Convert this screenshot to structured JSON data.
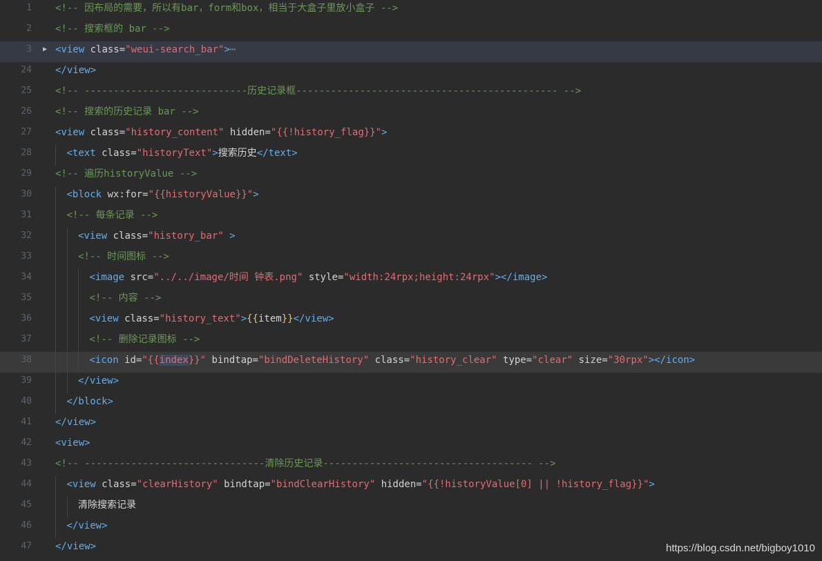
{
  "editor": {
    "lines": [
      {
        "num": "1",
        "indent": 0,
        "tokens": [
          [
            "c-comment",
            "<!-- 因布局的需要，所以有bar，form和box，相当于大盒子里放小盒子 -->"
          ]
        ]
      },
      {
        "num": "2",
        "indent": 0,
        "tokens": [
          [
            "c-comment",
            "<!-- 搜索框的 bar -->"
          ]
        ]
      },
      {
        "num": "3",
        "indent": 0,
        "fold": "▶",
        "highlight": "hl",
        "tokens": [
          [
            "c-tag",
            "<view"
          ],
          [
            "c-attr",
            " class="
          ],
          [
            "c-str",
            "\"weui-search_bar\""
          ],
          [
            "c-tag",
            ">"
          ],
          [
            "c-ellipsis",
            "⋯"
          ]
        ]
      },
      {
        "num": "24",
        "indent": 0,
        "tokens": [
          [
            "c-tag",
            "</view>"
          ]
        ]
      },
      {
        "num": "25",
        "indent": 0,
        "tokens": [
          [
            "c-comment",
            "<!-- ----------------------------历史记录框--------------------------------------------- -->"
          ]
        ]
      },
      {
        "num": "26",
        "indent": 0,
        "tokens": [
          [
            "c-comment",
            "<!-- 搜索的历史记录 bar -->"
          ]
        ]
      },
      {
        "num": "27",
        "indent": 0,
        "tokens": [
          [
            "c-tag",
            "<view"
          ],
          [
            "c-attr",
            " class="
          ],
          [
            "c-str",
            "\"history_content\""
          ],
          [
            "c-attr",
            " hidden="
          ],
          [
            "c-str",
            "\"{{!history_flag}}\""
          ],
          [
            "c-tag",
            ">"
          ]
        ]
      },
      {
        "num": "28",
        "indent": 1,
        "tokens": [
          [
            "c-tag",
            "<text"
          ],
          [
            "c-attr",
            " class="
          ],
          [
            "c-str",
            "\"historyText\""
          ],
          [
            "c-tag",
            ">"
          ],
          [
            "c-text",
            "搜索历史"
          ],
          [
            "c-tag",
            "</text>"
          ]
        ]
      },
      {
        "num": "29",
        "indent": 0,
        "tokens": [
          [
            "c-comment",
            "<!-- 遍历historyValue -->"
          ]
        ]
      },
      {
        "num": "30",
        "indent": 1,
        "tokens": [
          [
            "c-tag",
            "<block"
          ],
          [
            "c-attr",
            " wx:for="
          ],
          [
            "c-str",
            "\"{{historyValue}}\""
          ],
          [
            "c-tag",
            ">"
          ]
        ]
      },
      {
        "num": "31",
        "indent": 1,
        "tokens": [
          [
            "c-comment",
            "<!-- 每条记录 -->"
          ]
        ]
      },
      {
        "num": "32",
        "indent": 2,
        "tokens": [
          [
            "c-tag",
            "<view"
          ],
          [
            "c-attr",
            " class="
          ],
          [
            "c-str",
            "\"history_bar\""
          ],
          [
            "c-tag",
            " >"
          ]
        ]
      },
      {
        "num": "33",
        "indent": 2,
        "tokens": [
          [
            "c-comment",
            "<!-- 时间图标 -->"
          ]
        ]
      },
      {
        "num": "34",
        "indent": 3,
        "tokens": [
          [
            "c-tag",
            "<image"
          ],
          [
            "c-attr",
            " src="
          ],
          [
            "c-str",
            "\"../../image/时间 钟表.png\""
          ],
          [
            "c-attr",
            " style="
          ],
          [
            "c-str",
            "\"width:24rpx;height:24rpx\""
          ],
          [
            "c-tag",
            "></image>"
          ]
        ]
      },
      {
        "num": "35",
        "indent": 3,
        "tokens": [
          [
            "c-comment",
            "<!-- 内容 -->"
          ]
        ]
      },
      {
        "num": "36",
        "indent": 3,
        "tokens": [
          [
            "c-tag",
            "<view"
          ],
          [
            "c-attr",
            " class="
          ],
          [
            "c-str",
            "\"history_text\""
          ],
          [
            "c-tag",
            ">"
          ],
          [
            "c-brace",
            "{{"
          ],
          [
            "c-text",
            "item"
          ],
          [
            "c-brace",
            "}}"
          ],
          [
            "c-tag",
            "</view>"
          ]
        ]
      },
      {
        "num": "37",
        "indent": 3,
        "tokens": [
          [
            "c-comment",
            "<!-- 删除记录图标 -->"
          ]
        ]
      },
      {
        "num": "38",
        "indent": 3,
        "highlight": "hl-current",
        "tokens": [
          [
            "c-tag",
            "<icon"
          ],
          [
            "c-attr",
            " id="
          ],
          [
            "c-str",
            "\"{{"
          ],
          [
            "c-str sel",
            "index"
          ],
          [
            "c-str",
            "}}\""
          ],
          [
            "c-attr",
            " bindtap="
          ],
          [
            "c-str",
            "\"bindDeleteHistory\""
          ],
          [
            "c-attr",
            " class="
          ],
          [
            "c-str",
            "\"history_clear\""
          ],
          [
            "c-attr",
            " type="
          ],
          [
            "c-str",
            "\"clear\""
          ],
          [
            "c-attr",
            " size="
          ],
          [
            "c-str",
            "\"30rpx\""
          ],
          [
            "c-tag",
            "></icon>"
          ]
        ]
      },
      {
        "num": "39",
        "indent": 2,
        "tokens": [
          [
            "c-tag",
            "</view>"
          ]
        ]
      },
      {
        "num": "40",
        "indent": 1,
        "tokens": [
          [
            "c-tag",
            "</block>"
          ]
        ]
      },
      {
        "num": "41",
        "indent": 0,
        "tokens": [
          [
            "c-tag",
            "</view>"
          ]
        ]
      },
      {
        "num": "42",
        "indent": 0,
        "tokens": [
          [
            "c-tag",
            "<view>"
          ]
        ]
      },
      {
        "num": "43",
        "indent": 0,
        "tokens": [
          [
            "c-comment",
            "<!-- -------------------------------清除历史记录------------------------------------ -->"
          ]
        ]
      },
      {
        "num": "44",
        "indent": 1,
        "tokens": [
          [
            "c-tag",
            "<view"
          ],
          [
            "c-attr",
            " class="
          ],
          [
            "c-str",
            "\"clearHistory\""
          ],
          [
            "c-attr",
            " bindtap="
          ],
          [
            "c-str",
            "\"bindClearHistory\""
          ],
          [
            "c-attr",
            " hidden="
          ],
          [
            "c-str",
            "\"{{!historyValue[0] || !history_flag}}\""
          ],
          [
            "c-tag",
            ">"
          ]
        ]
      },
      {
        "num": "45",
        "indent": 2,
        "tokens": [
          [
            "c-text",
            "清除搜索记录"
          ]
        ]
      },
      {
        "num": "46",
        "indent": 1,
        "tokens": [
          [
            "c-tag",
            "</view>"
          ]
        ]
      },
      {
        "num": "47",
        "indent": 0,
        "tokens": [
          [
            "c-tag",
            "</view>"
          ]
        ]
      }
    ]
  },
  "watermark": "https://blog.csdn.net/bigboy1010"
}
